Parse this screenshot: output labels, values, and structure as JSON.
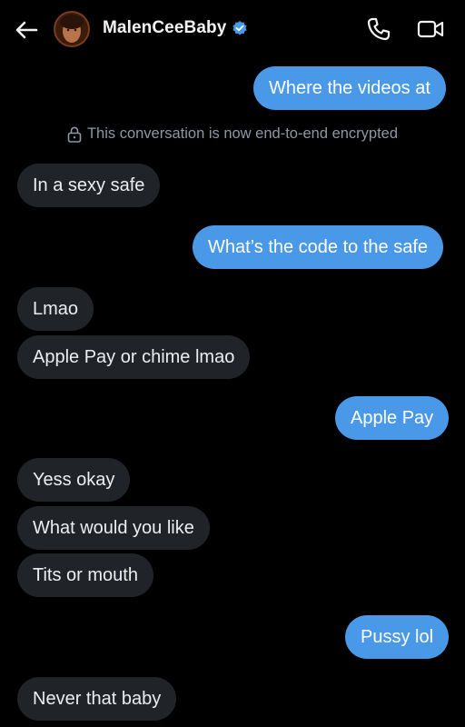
{
  "header": {
    "contact_name": "MalenCeeBaby",
    "icons": {
      "back": "arrow-left-icon",
      "verified": "verified-badge-icon",
      "call": "phone-icon",
      "video": "video-camera-icon"
    },
    "accent": "#4a99e9"
  },
  "encryption_notice": "This conversation is now end-to-end encrypted",
  "messages": [
    {
      "direction": "outgoing",
      "text": "Where the videos at"
    },
    {
      "direction": "incoming",
      "text": "In a sexy safe"
    },
    {
      "direction": "outgoing",
      "text": "What’s the code to the safe"
    },
    {
      "direction": "incoming",
      "text": "Lmao"
    },
    {
      "direction": "incoming",
      "text": "Apple Pay or chime lmao"
    },
    {
      "direction": "outgoing",
      "text": "Apple Pay"
    },
    {
      "direction": "incoming",
      "text": "Yess okay"
    },
    {
      "direction": "incoming",
      "text": "What would you like"
    },
    {
      "direction": "incoming",
      "text": "Tits or mouth"
    },
    {
      "direction": "outgoing",
      "text": "Pussy lol"
    },
    {
      "direction": "incoming",
      "text": "Never that baby"
    }
  ],
  "colors": {
    "outgoing_bubble": "#4a99e9",
    "incoming_bubble": "#202327",
    "background": "#000000",
    "muted_text": "#8b98a5"
  }
}
